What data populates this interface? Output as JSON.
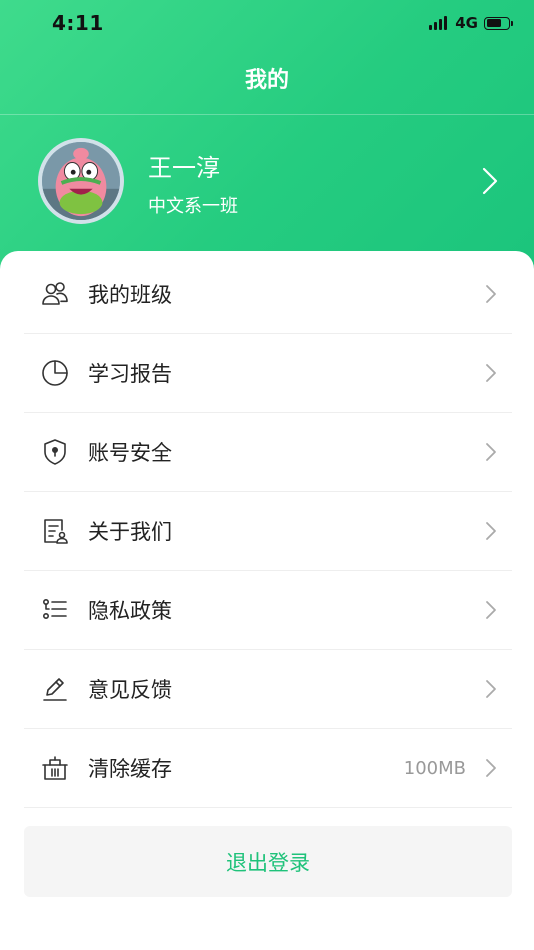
{
  "status_bar": {
    "time": "4:11",
    "network": "4G"
  },
  "nav": {
    "title": "我的"
  },
  "profile": {
    "name": "王一淳",
    "class": "中文系一班"
  },
  "menu": [
    {
      "label": "我的班级",
      "icon": "class-icon"
    },
    {
      "label": "学习报告",
      "icon": "report-icon"
    },
    {
      "label": "账号安全",
      "icon": "shield-icon"
    },
    {
      "label": "关于我们",
      "icon": "about-icon"
    },
    {
      "label": "隐私政策",
      "icon": "privacy-icon"
    },
    {
      "label": "意见反馈",
      "icon": "pencil-icon"
    },
    {
      "label": "清除缓存",
      "icon": "basket-icon",
      "value": "100MB"
    }
  ],
  "logout": {
    "label": "退出登录"
  },
  "colors": {
    "accent": "#1fc27a",
    "header_start": "#3fdb8c",
    "header_end": "#1bc47c"
  }
}
